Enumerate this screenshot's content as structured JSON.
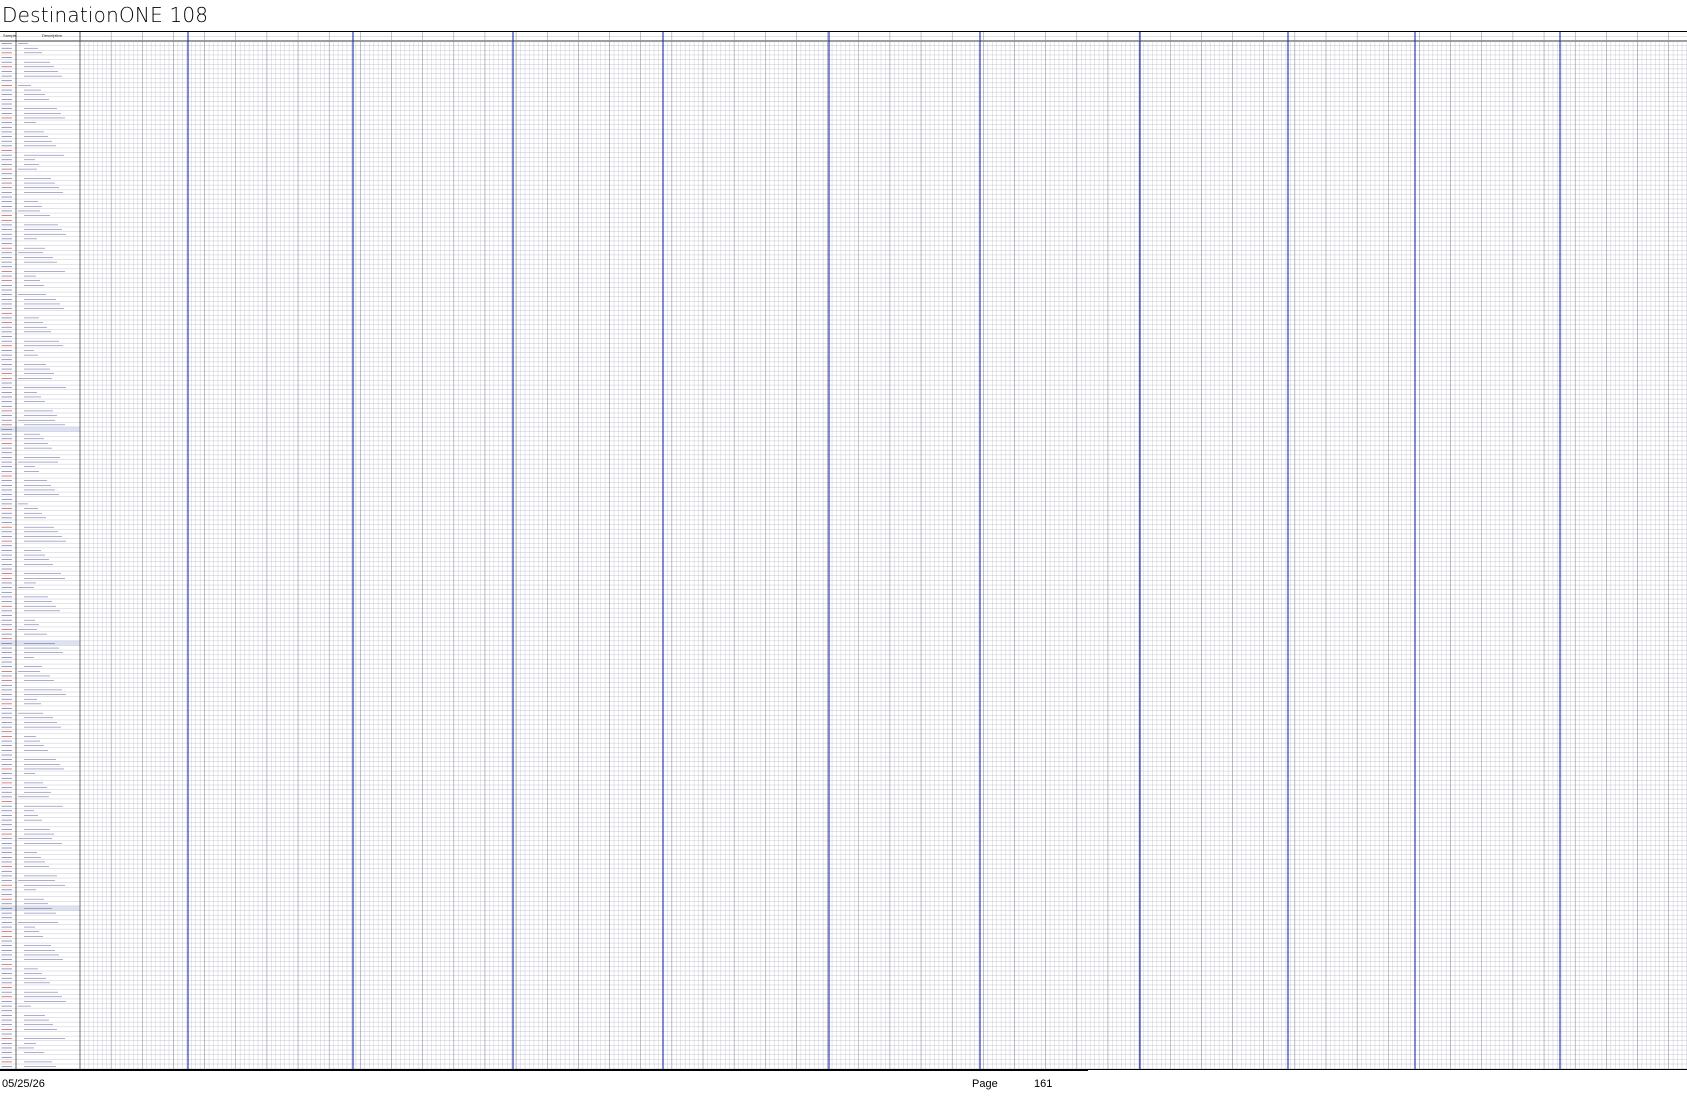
{
  "document": {
    "title": "DestinationONE 108"
  },
  "grid": {
    "header_labels": [
      "Sample",
      "Description"
    ],
    "month_separator_color": "#1a2fa8",
    "gridline_color": "#b8b8c8",
    "row_label_color": "#5a5a9a",
    "highlight_row_color": "#dde3f3"
  },
  "footer": {
    "date": "05/25/26",
    "page_label": "Page",
    "page_number": "161"
  }
}
